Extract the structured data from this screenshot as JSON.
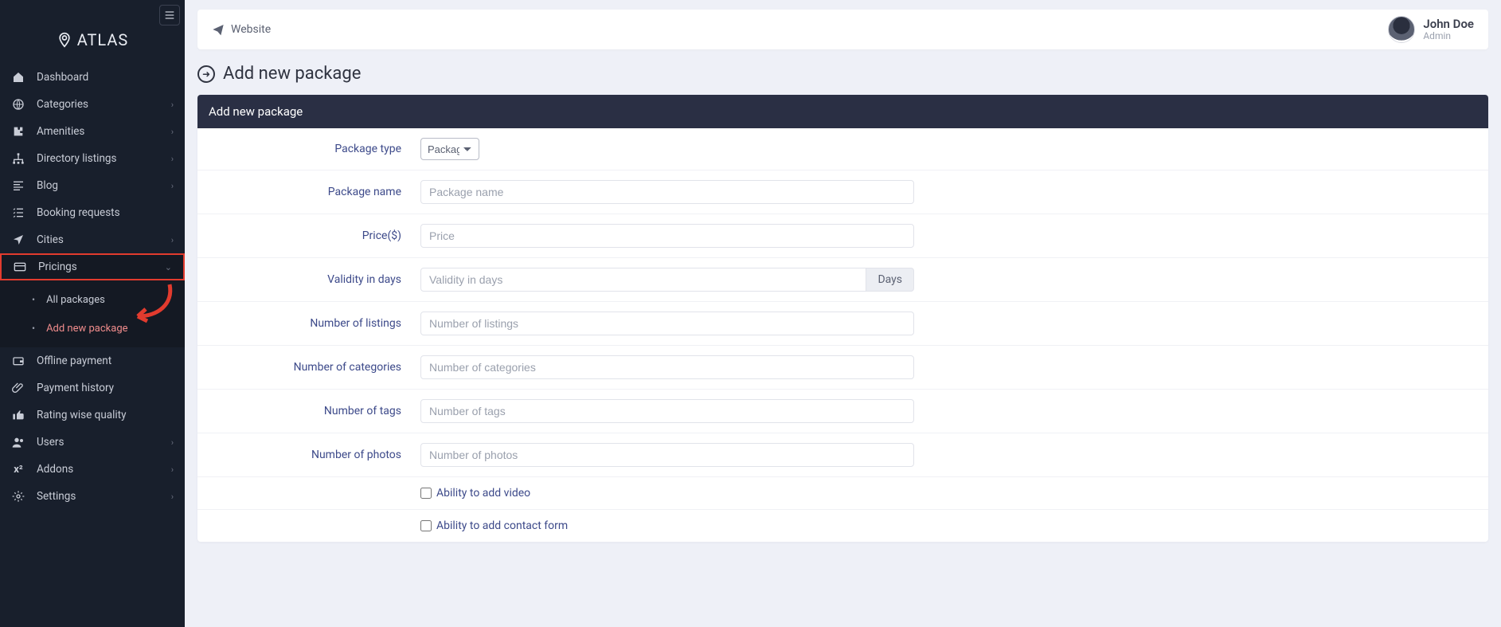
{
  "brand": {
    "name": "ATLAS"
  },
  "sidebar": {
    "items": [
      {
        "label": "Dashboard"
      },
      {
        "label": "Categories"
      },
      {
        "label": "Amenities"
      },
      {
        "label": "Directory listings"
      },
      {
        "label": "Blog"
      },
      {
        "label": "Booking requests"
      },
      {
        "label": "Cities"
      },
      {
        "label": "Pricings"
      },
      {
        "label": "Offline payment"
      },
      {
        "label": "Payment history"
      },
      {
        "label": "Rating wise quality"
      },
      {
        "label": "Users"
      },
      {
        "label": "Addons"
      },
      {
        "label": "Settings"
      }
    ],
    "pricings_sub": [
      {
        "label": "All packages"
      },
      {
        "label": "Add new package"
      }
    ]
  },
  "topbar": {
    "website_link": "Website"
  },
  "user": {
    "name": "John Doe",
    "role": "Admin"
  },
  "page": {
    "title": "Add new package"
  },
  "card": {
    "header": "Add new package"
  },
  "form": {
    "package_type": {
      "label": "Package type",
      "selected": "Packag…"
    },
    "package_name": {
      "label": "Package name",
      "placeholder": "Package name"
    },
    "price": {
      "label": "Price($)",
      "placeholder": "Price"
    },
    "validity": {
      "label": "Validity in days",
      "placeholder": "Validity in days",
      "addon": "Days"
    },
    "listings": {
      "label": "Number of listings",
      "placeholder": "Number of listings"
    },
    "categories": {
      "label": "Number of categories",
      "placeholder": "Number of categories"
    },
    "tags": {
      "label": "Number of tags",
      "placeholder": "Number of tags"
    },
    "photos": {
      "label": "Number of photos",
      "placeholder": "Number of photos"
    },
    "video": {
      "label": "Ability to add video"
    },
    "contact": {
      "label": "Ability to add contact form"
    }
  }
}
